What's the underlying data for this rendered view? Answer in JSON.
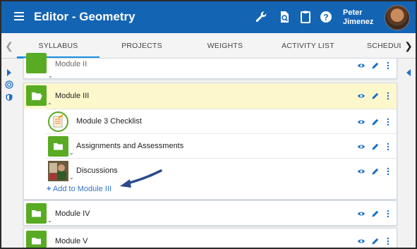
{
  "header": {
    "title": "Editor - Geometry",
    "user_first": "Peter",
    "user_last": "Jimenez",
    "icons": [
      "menu-icon",
      "wrench-icon",
      "document-search-icon",
      "clipboard-icon",
      "help-icon"
    ]
  },
  "tabs": [
    {
      "label": "SYLLABUS",
      "active": true
    },
    {
      "label": "PROJECTS",
      "active": false
    },
    {
      "label": "WEIGHTS",
      "active": false
    },
    {
      "label": "ACTIVITY LIST",
      "active": false
    },
    {
      "label": "SCHEDULI",
      "active": false
    }
  ],
  "modules": [
    {
      "title": "Module II"
    },
    {
      "title": "Module III",
      "expanded": true,
      "items": [
        {
          "title": "Module 3 Checklist",
          "icon": "checklist-icon"
        },
        {
          "title": "Assignments and Assessments",
          "icon": "folder-icon"
        },
        {
          "title": "Discussions",
          "icon": "photo-thumbnail-icon"
        }
      ],
      "add_label": "Add to Module III"
    },
    {
      "title": "Module IV"
    },
    {
      "title": "Module V"
    }
  ],
  "colors": {
    "appbar": "#1464b4",
    "folder": "#58ab23",
    "highlight": "#fdf8cc",
    "link": "#2f74c2",
    "tab_underline": "#1b8fde"
  }
}
